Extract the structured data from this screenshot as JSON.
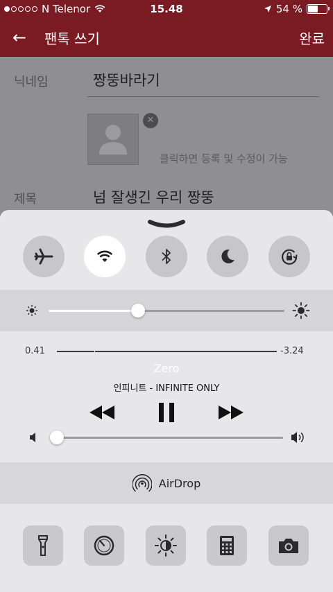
{
  "status_bar": {
    "carrier": "N Telenor",
    "time": "15.48",
    "battery_percent": "54 %",
    "battery_level": 0.54
  },
  "nav": {
    "title": "팬톡 쓰기",
    "done": "완료"
  },
  "form": {
    "nickname_label": "닉네임",
    "nickname_value": "짱뚱바라기",
    "photo_hint": "클릭하면 등록 및 수정이 가능",
    "subject_label": "제목",
    "subject_value": "넘 잘생긴 우리 짱뚱"
  },
  "control_center": {
    "toggles": [
      {
        "name": "airplane",
        "icon": "airplane-icon",
        "active": false
      },
      {
        "name": "wifi",
        "icon": "wifi-icon",
        "active": true
      },
      {
        "name": "bluetooth",
        "icon": "bluetooth-icon",
        "active": false
      },
      {
        "name": "do-not-disturb",
        "icon": "moon-icon",
        "active": false
      },
      {
        "name": "rotation-lock",
        "icon": "rotation-lock-icon",
        "active": false
      }
    ],
    "brightness": 0.38,
    "music": {
      "elapsed": "0.41",
      "remaining": "-3.24",
      "progress": 0.17,
      "title": "Zero",
      "artist": "인피니트 - INFINITE ONLY"
    },
    "volume": 0.0,
    "airdrop_label": "AirDrop",
    "shortcuts": [
      "flashlight-icon",
      "timer-icon",
      "night-shift-icon",
      "calculator-icon",
      "camera-icon"
    ]
  },
  "colors": {
    "nav_bar": "#7a1a22",
    "control_center_bg": "#e7e7ea",
    "toggle_active": "#ffffff",
    "toggle_inactive": "#c6c6cb"
  }
}
